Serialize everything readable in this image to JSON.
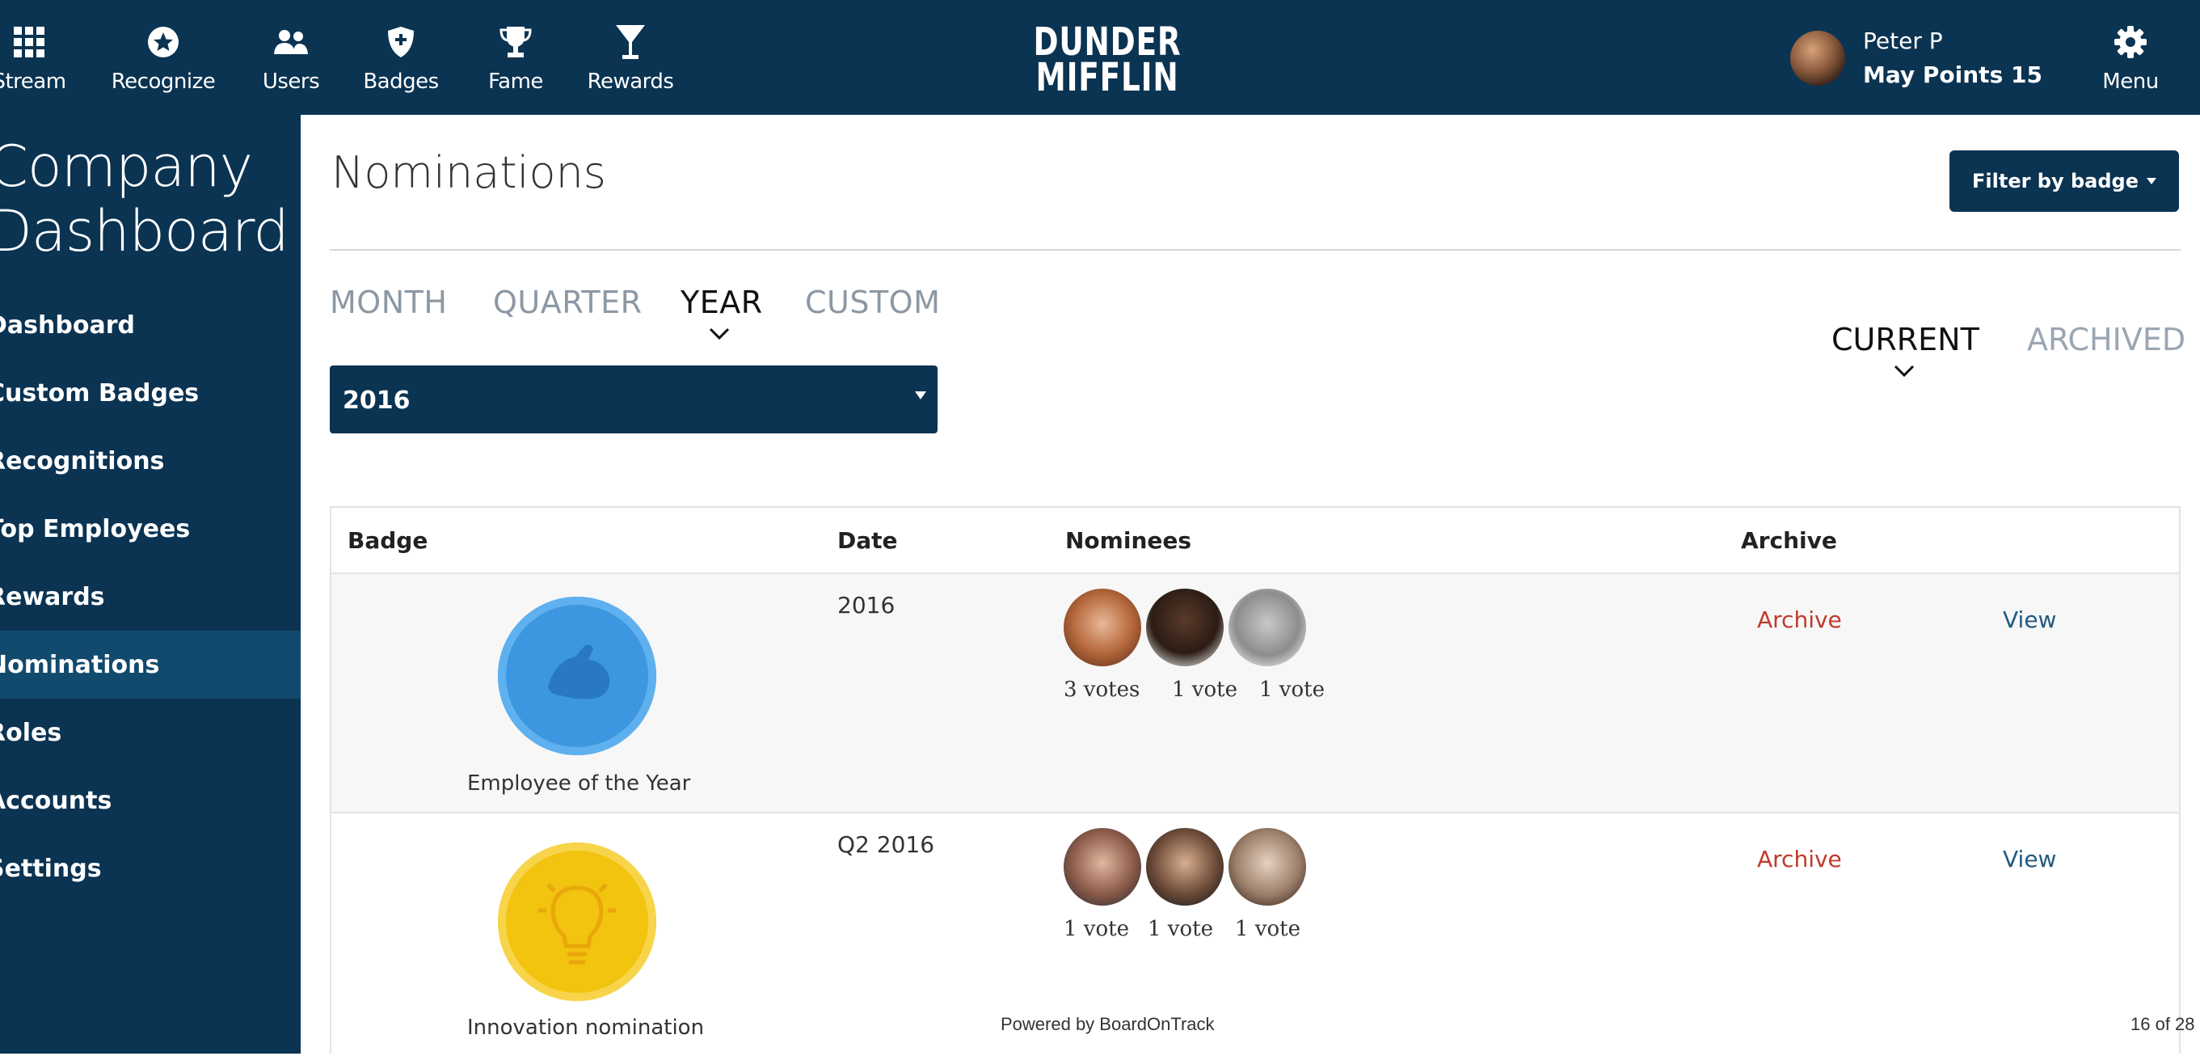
{
  "nav": {
    "items": [
      {
        "label": "Stream",
        "icon": "grid-icon"
      },
      {
        "label": "Recognize",
        "icon": "star-circle-icon"
      },
      {
        "label": "Users",
        "icon": "users-icon"
      },
      {
        "label": "Badges",
        "icon": "shield-icon"
      },
      {
        "label": "Fame",
        "icon": "trophy-icon"
      },
      {
        "label": "Rewards",
        "icon": "cocktail-icon"
      }
    ],
    "brand_line1": "DUNDER",
    "brand_line2": "MIFFLIN",
    "user_name": "Peter P",
    "user_points": "May Points 15",
    "menu_label": "Menu"
  },
  "sidebar": {
    "title_line1": "Company",
    "title_line2": "Dashboard",
    "items": [
      {
        "label": "Dashboard"
      },
      {
        "label": "Custom Badges"
      },
      {
        "label": "Recognitions"
      },
      {
        "label": "Top Employees"
      },
      {
        "label": "Rewards"
      },
      {
        "label": "Nominations"
      },
      {
        "label": "Roles"
      },
      {
        "label": "Accounts"
      },
      {
        "label": "Settings"
      }
    ],
    "active_index": 5
  },
  "main": {
    "title": "Nominations",
    "filter_label": "Filter by badge",
    "period_tabs": [
      "MONTH",
      "QUARTER",
      "YEAR",
      "CUSTOM"
    ],
    "active_period": "YEAR",
    "year_value": "2016",
    "status_tabs": [
      "CURRENT",
      "ARCHIVED"
    ],
    "active_status": "CURRENT",
    "columns": [
      "Badge",
      "Date",
      "Nominees",
      "Archive"
    ],
    "rows": [
      {
        "badge_name": "Employee of the Year",
        "badge_icon": "flexed-arm-icon",
        "badge_color": "#3c97e0",
        "date": "2016",
        "votes": [
          "3 votes",
          "1 vote",
          "1 vote"
        ],
        "archive": "Archive",
        "view": "View"
      },
      {
        "badge_name": "Innovation nomination",
        "badge_icon": "lightbulb-icon",
        "badge_color": "#f2c30f",
        "date": "Q2 2016",
        "votes": [
          "1 vote",
          "1 vote",
          "1 vote"
        ],
        "archive": "Archive",
        "view": "View"
      }
    ]
  },
  "footer": {
    "powered": "Powered by BoardOnTrack",
    "page": "16 of 28"
  },
  "colors": {
    "navy": "#0b3352",
    "archive_red": "#c0392b",
    "view_blue": "#1f5a82"
  }
}
